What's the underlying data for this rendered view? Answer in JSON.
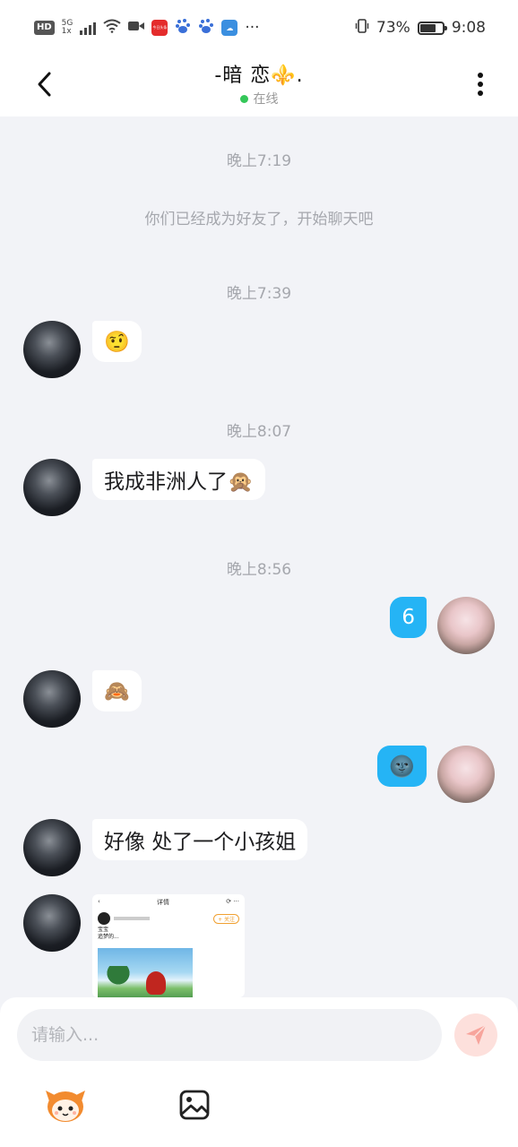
{
  "status_bar": {
    "hd": "HD",
    "net_top": "5G",
    "net_bottom": "1x",
    "app_badge": "今日头条",
    "more": "···",
    "battery": "73%",
    "time": "9:08"
  },
  "header": {
    "title": "-暗 恋⚜️.",
    "status": "在线"
  },
  "chat": {
    "items": [
      {
        "type": "time",
        "text": "晚上7:19"
      },
      {
        "type": "system",
        "text": "你们已经成为好友了，开始聊天吧"
      },
      {
        "type": "time",
        "text": "晚上7:39"
      },
      {
        "type": "in",
        "text": "🤨"
      },
      {
        "type": "time",
        "text": "晚上8:07"
      },
      {
        "type": "in",
        "text": "我成非洲人了🙊"
      },
      {
        "type": "time",
        "text": "晚上8:56"
      },
      {
        "type": "out",
        "text": "6"
      },
      {
        "type": "in",
        "text": "🙈"
      },
      {
        "type": "out",
        "text": "🌚"
      },
      {
        "type": "in",
        "text": "好像 处了一个小孩姐"
      }
    ],
    "image_preview": {
      "header_title": "详情",
      "follow": "+ 关注",
      "line1": "宝宝",
      "line2": "追梦的..."
    }
  },
  "input": {
    "placeholder": "请输入..."
  },
  "colors": {
    "accent_blue": "#25b4f5",
    "send_bg": "#fde0dc",
    "send_icon": "#f7a49c",
    "online_green": "#34c759",
    "background": "#f2f3f7"
  },
  "icons": {
    "back": "chevron-left-icon",
    "more": "more-vertical-icon",
    "send": "send-icon",
    "mascot": "mascot-icon",
    "image": "image-icon"
  }
}
